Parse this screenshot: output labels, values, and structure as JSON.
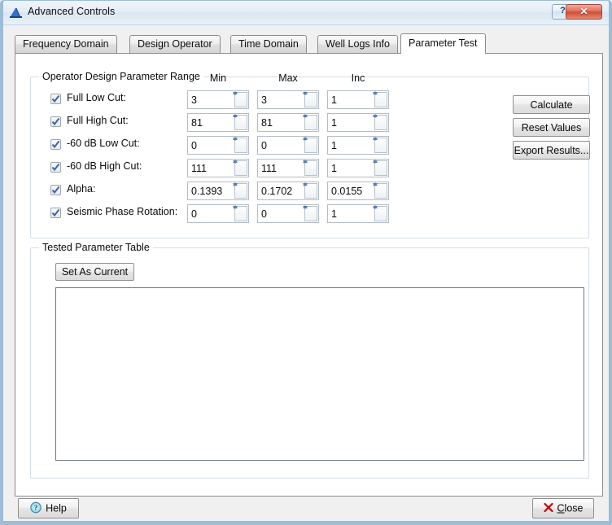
{
  "window": {
    "title": "Advanced Controls",
    "icon": "app-mountain-icon",
    "buttons": {
      "help_label": "?",
      "close_label": "✕"
    }
  },
  "tabs": [
    {
      "label": "Frequency Domain",
      "active": false
    },
    {
      "label": "Design Operator",
      "active": false
    },
    {
      "label": "Time Domain",
      "active": false
    },
    {
      "label": "Well Logs Info",
      "active": false
    },
    {
      "label": "Parameter Test",
      "active": true
    }
  ],
  "parameter_range": {
    "title": "Operator Design Parameter Range",
    "columns": [
      "Min",
      "Max",
      "Inc"
    ],
    "rows": [
      {
        "label": "Full Low Cut:",
        "checked": true,
        "min": "3",
        "max": "3",
        "inc": "1"
      },
      {
        "label": "Full High Cut:",
        "checked": true,
        "min": "81",
        "max": "81",
        "inc": "1"
      },
      {
        "label": "-60 dB Low Cut:",
        "checked": true,
        "min": "0",
        "max": "0",
        "inc": "1"
      },
      {
        "label": "-60 dB High Cut:",
        "checked": true,
        "min": "111",
        "max": "111",
        "inc": "1"
      },
      {
        "label": "Alpha:",
        "checked": true,
        "min": "0.1393",
        "max": "0.1702",
        "inc": "0.0155"
      },
      {
        "label": "Seismic Phase Rotation:",
        "checked": true,
        "min": "0",
        "max": "0",
        "inc": "1"
      }
    ],
    "actions": {
      "calculate": "Calculate",
      "reset": "Reset Values",
      "export": "Export Results..."
    }
  },
  "tested_table": {
    "title": "Tested Parameter Table",
    "set_as_current": "Set As Current",
    "rows": []
  },
  "footer": {
    "help": "Help",
    "close_prefix": "",
    "close_accel": "C",
    "close_rest": "lose",
    "close_full": "Close"
  },
  "colors": {
    "accent_blue": "#5a7fb0",
    "close_red": "#cc4e38",
    "window_border": "#9cbcd8",
    "panel_bg": "#f0f0f0",
    "page_bg": "#ffffff"
  }
}
